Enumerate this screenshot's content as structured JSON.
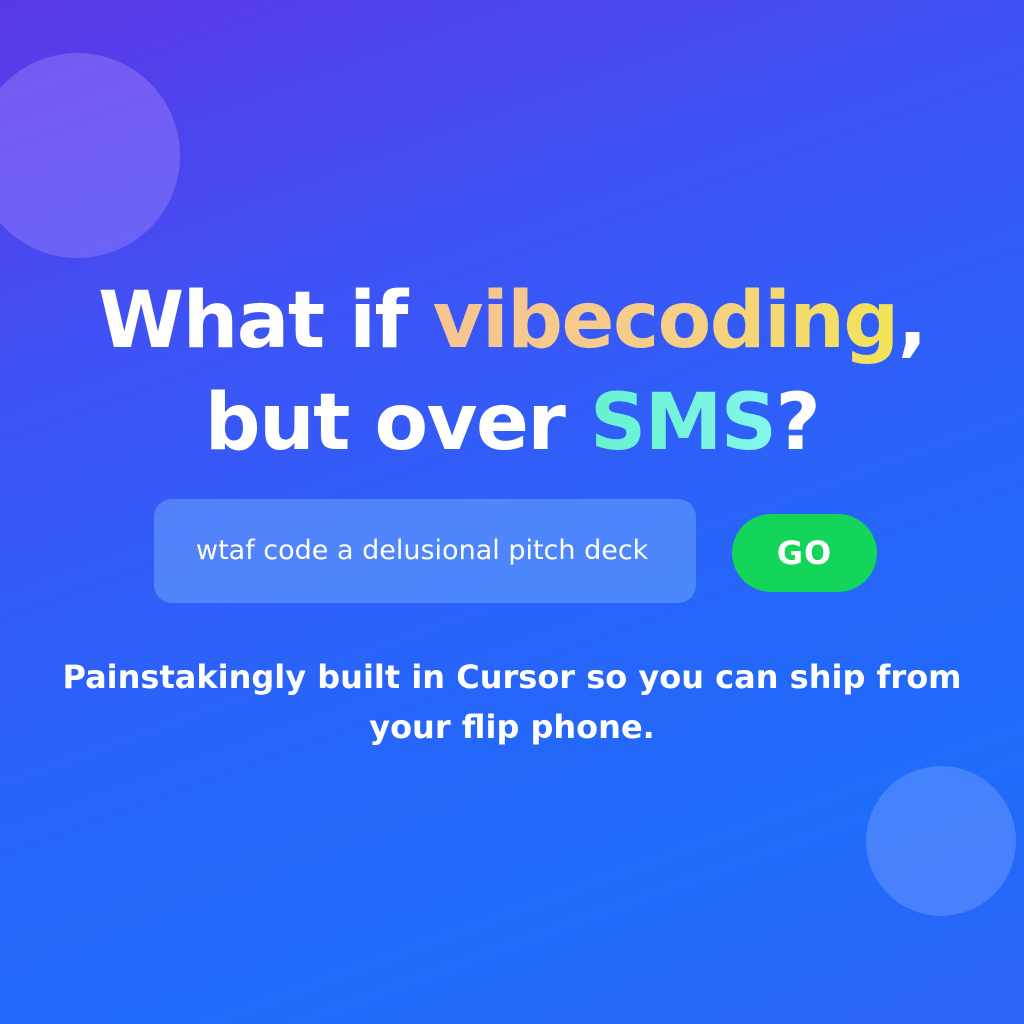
{
  "hero": {
    "headline": {
      "part1": "What if ",
      "highlight1": "vibecoding",
      "part2": ",",
      "part3": "but over ",
      "highlight2": "SMS",
      "part4": "?"
    },
    "prompt": {
      "value": "wtaf code a delusional pitch deck"
    },
    "go_label": "GO",
    "tagline": "Painstakingly built in Cursor so you can ship from your flip phone."
  },
  "colors": {
    "background_start": "#5b38e6",
    "background_end": "#1f6cfb",
    "highlight_vibecoding": "#f6cf86",
    "highlight_sms": "#74f4dc",
    "go_button": "#12d55a"
  }
}
